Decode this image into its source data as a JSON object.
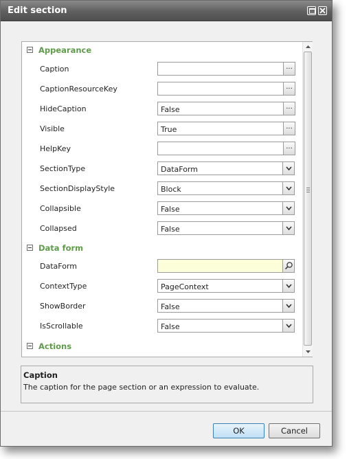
{
  "window": {
    "title": "Edit section"
  },
  "groups": {
    "appearance": "Appearance",
    "data_form": "Data form",
    "actions": "Actions"
  },
  "properties": [
    {
      "label": "Caption",
      "value": "",
      "control": "ellipsis"
    },
    {
      "label": "CaptionResourceKey",
      "value": "",
      "control": "ellipsis"
    },
    {
      "label": "HideCaption",
      "value": "False",
      "control": "ellipsis"
    },
    {
      "label": "Visible",
      "value": "True",
      "control": "ellipsis"
    },
    {
      "label": "HelpKey",
      "value": "",
      "control": "ellipsis"
    },
    {
      "label": "SectionType",
      "value": "DataForm",
      "control": "dropdown"
    },
    {
      "label": "SectionDisplayStyle",
      "value": "Block",
      "control": "dropdown"
    },
    {
      "label": "Collapsible",
      "value": "False",
      "control": "dropdown"
    },
    {
      "label": "Collapsed",
      "value": "False",
      "control": "dropdown"
    },
    {
      "label": "DataForm",
      "value": "",
      "control": "search"
    },
    {
      "label": "ContextType",
      "value": "PageContext",
      "control": "dropdown"
    },
    {
      "label": "ShowBorder",
      "value": "False",
      "control": "dropdown"
    },
    {
      "label": "IsScrollable",
      "value": "False",
      "control": "dropdown"
    }
  ],
  "ellipsis_label": "...",
  "description": {
    "title": "Caption",
    "text": "The caption for the page section or an expression to evaluate."
  },
  "buttons": {
    "ok": "OK",
    "cancel": "Cancel"
  },
  "colors": {
    "group_label": "#5f9b4a",
    "dataform_field_bg": "#fcfdd9",
    "ok_border": "#3c7fb1"
  },
  "icons": [
    "maximize-icon",
    "close-icon",
    "collapse-icon",
    "chevron-down-icon",
    "search-icon",
    "scroll-up-icon",
    "scroll-down-icon"
  ]
}
